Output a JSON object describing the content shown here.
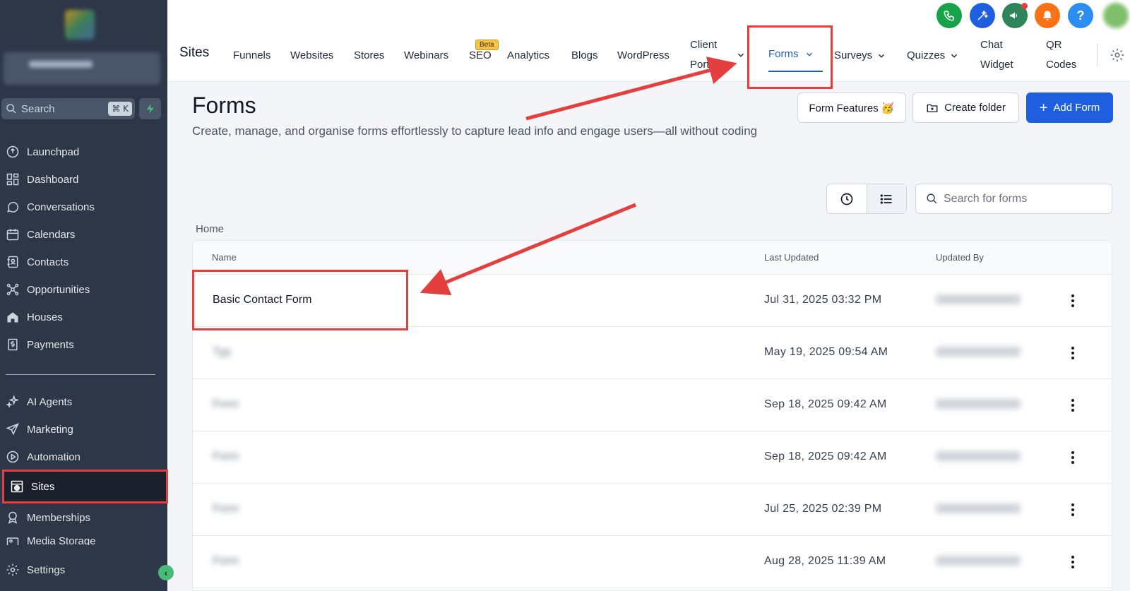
{
  "sidebar": {
    "search": {
      "label": "Search",
      "shortcut": "⌘ K"
    },
    "items": [
      {
        "label": "Launchpad",
        "icon": "rocket-icon"
      },
      {
        "label": "Dashboard",
        "icon": "grid-icon"
      },
      {
        "label": "Conversations",
        "icon": "chat-icon"
      },
      {
        "label": "Calendars",
        "icon": "calendar-icon"
      },
      {
        "label": "Contacts",
        "icon": "contacts-icon"
      },
      {
        "label": "Opportunities",
        "icon": "network-icon"
      },
      {
        "label": "Houses",
        "icon": "house-icon"
      },
      {
        "label": "Payments",
        "icon": "invoice-icon"
      }
    ],
    "items2": [
      {
        "label": "AI Agents",
        "icon": "sparkle-icon"
      },
      {
        "label": "Marketing",
        "icon": "send-icon"
      },
      {
        "label": "Automation",
        "icon": "play-icon"
      },
      {
        "label": "Sites",
        "icon": "globe-icon",
        "active": true
      },
      {
        "label": "Memberships",
        "icon": "badge-icon"
      },
      {
        "label": "Media Storage",
        "icon": "media-icon"
      }
    ],
    "settings": "Settings"
  },
  "topbar": {
    "section": "Sites",
    "tabs": [
      "Funnels",
      "Websites",
      "Stores",
      "Webinars",
      "SEO",
      "Analytics",
      "Blogs",
      "WordPress"
    ],
    "beta_badge": "Beta",
    "client_portal": [
      "Client",
      "Portal"
    ],
    "forms": "Forms",
    "surveys": "Surveys",
    "quizzes": "Quizzes",
    "chat_widget": [
      "Chat",
      "Widget"
    ],
    "qr_codes": [
      "QR",
      "Codes"
    ]
  },
  "main": {
    "title": "Forms",
    "description": "Create, manage, and organise forms effortlessly to capture lead info and engage users—all without coding",
    "buttons": {
      "features": "Form Features 🥳",
      "folder": "Create folder",
      "add": "Add Form"
    },
    "search_placeholder": "Search for forms",
    "breadcrumb": "Home",
    "columns": [
      "Name",
      "Last Updated",
      "Updated By"
    ],
    "rows": [
      {
        "name": "Basic Contact Form",
        "updated": "Jul 31, 2025 03:32 PM",
        "blurred": false
      },
      {
        "name": "Typ",
        "updated": "May 19, 2025 09:54 AM",
        "blurred": true
      },
      {
        "name": "Form",
        "updated": "Sep 18, 2025 09:42 AM",
        "blurred": true
      },
      {
        "name": "Form",
        "updated": "Sep 18, 2025 09:42 AM",
        "blurred": true
      },
      {
        "name": "Form",
        "updated": "Jul 25, 2025 02:39 PM",
        "blurred": true
      },
      {
        "name": "Form",
        "updated": "Aug 28, 2025 11:39 AM",
        "blurred": true
      }
    ]
  },
  "colors": {
    "accent": "#1e5fe0",
    "highlight": "#e53e3e",
    "sidebar": "#2d3748"
  }
}
